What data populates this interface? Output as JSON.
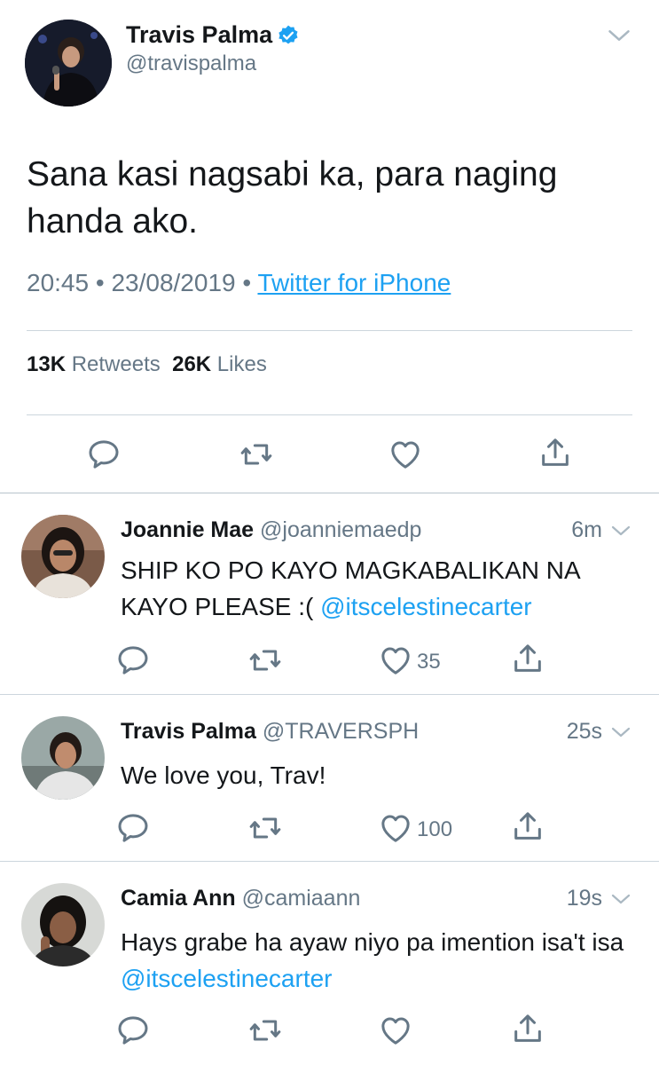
{
  "main_tweet": {
    "name": "Travis Palma",
    "handle": "@travispalma",
    "text": "Sana kasi nagsabi ka, para naging handa ako.",
    "time": "20:45",
    "date": "23/08/2019",
    "separator": "•",
    "source": "Twitter for iPhone",
    "retweets_count": "13K",
    "retweets_label": "Retweets",
    "likes_count": "26K",
    "likes_label": "Likes"
  },
  "replies": [
    {
      "name": "Joannie Mae",
      "handle": "@joanniemaedp",
      "time": "6m",
      "text": "SHIP KO PO KAYO MAGKABALIKAN NA KAYO PLEASE :( ",
      "mention": "@itscelestinecarter",
      "likes": "35"
    },
    {
      "name": "Travis Palma",
      "handle": "@TRAVERSPH",
      "time": "25s",
      "text": "We love you, Trav!",
      "mention": "",
      "likes": "100"
    },
    {
      "name": "Camia Ann",
      "handle": "@camiaann",
      "time": "19s",
      "text": "Hays grabe ha ayaw niyo pa imention isa't isa ",
      "mention": "@itscelestinecarter",
      "likes": ""
    }
  ],
  "colors": {
    "accent": "#1da1f2",
    "secondary_text": "#657786",
    "primary_text": "#14171a",
    "divider": "#ccd6dd"
  },
  "icons": [
    "verified-badge-icon",
    "chevron-down-icon",
    "reply-icon",
    "retweet-icon",
    "like-icon",
    "share-icon"
  ]
}
